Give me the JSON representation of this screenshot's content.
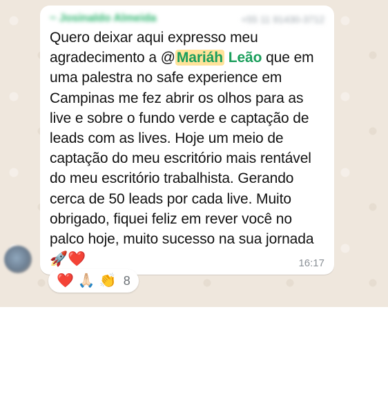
{
  "message": {
    "sender_name": "~ Josinaldo Almeida",
    "sender_phone": "+55 11 91430-3712",
    "text_before_mention": "Quero deixar aqui expresso meu agradecimento a @",
    "mention_highlight": "Mariáh",
    "mention_rest": "Leão",
    "text_after_mention": " que em uma palestra no safe experience em Campinas me fez abrir os olhos para as live e sobre o fundo verde e captação de leads com as lives. Hoje um meio de captação do meu escritório mais rentável do meu escritório trabalhista. Gerando cerca de 50 leads por cada live. Muito obrigado, fiquei feliz em rever você no palco hoje, muito sucesso na sua jornada ",
    "trailing_emojis": "🚀❤️",
    "time": "16:17"
  },
  "reactions": {
    "emojis": [
      "❤️",
      "🙏🏻",
      "👏"
    ],
    "count": "8"
  }
}
